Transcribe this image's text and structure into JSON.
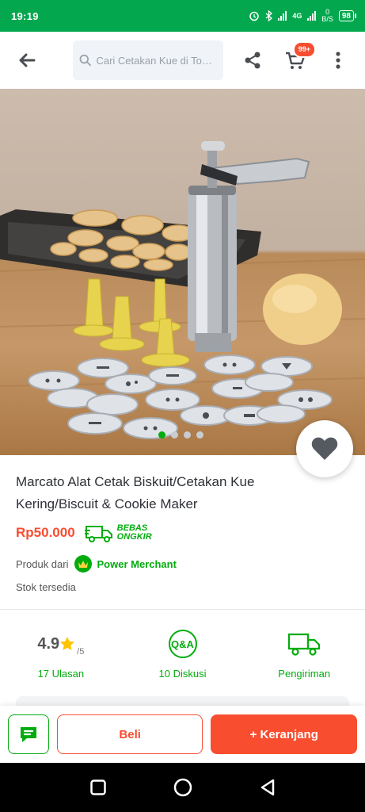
{
  "status_bar": {
    "time": "19:19",
    "network": "4G",
    "net_speed_value": "0",
    "net_speed_unit": "B/S",
    "battery": "98"
  },
  "header": {
    "search_placeholder": "Cari Cetakan Kue di Toko...",
    "cart_badge": "99+"
  },
  "gallery": {
    "image_count": 4,
    "active_index": 0
  },
  "product": {
    "title": "Marcato Alat Cetak Biskuit/Cetakan Kue Kering/Biscuit & Cookie Maker",
    "price": "Rp50.000",
    "free_shipping_line1": "BEBAS",
    "free_shipping_line2": "ONGKIR",
    "merchant_prefix": "Produk dari",
    "merchant_name": "Power Merchant",
    "stock": "Stok tersedia"
  },
  "stats": {
    "rating": "4.9",
    "rating_max": "/5",
    "reviews_label": "17 Ulasan",
    "qa_icon_text": "Q&A",
    "discussion_label": "10 Diskusi",
    "shipping_label": "Pengiriman"
  },
  "actions": {
    "buy_label": "Beli",
    "add_to_cart_label": "+ Keranjang"
  },
  "colors": {
    "brand_green": "#03ac0e",
    "status_green": "#03a84e",
    "accent_orange": "#f94d30"
  },
  "icons": [
    "back-arrow-icon",
    "search-icon",
    "share-icon",
    "cart-icon",
    "more-vert-icon",
    "heart-icon",
    "star-icon",
    "crown-icon",
    "truck-icon",
    "chat-icon",
    "nav-recent-icon",
    "nav-home-icon",
    "nav-back-icon"
  ]
}
